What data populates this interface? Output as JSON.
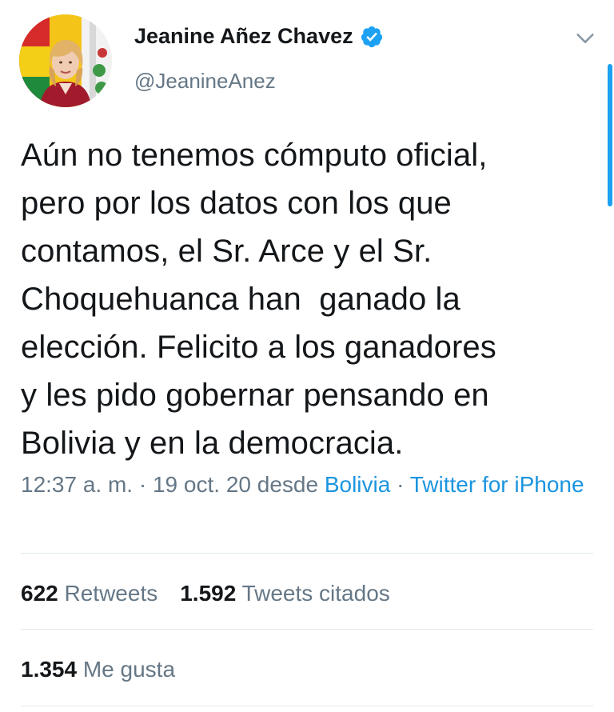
{
  "tweet": {
    "author": {
      "display_name": "Jeanine Añez Chavez",
      "handle": "@JeanineAnez",
      "verified": true,
      "avatar_icon": "profile-photo"
    },
    "text": "Aún no tenemos cómputo oficial,\npero por los datos con los que\ncontamos, el Sr. Arce y el Sr.\nChoquehuanca han  ganado la\nelección. Felicito a los ganadores\ny les pido gobernar pensando en\nBolivia y en la democracia.",
    "meta": {
      "time": "12:37 a. m.",
      "separator": " · ",
      "date": "19 oct. 20",
      "from_word": " desde ",
      "location": "Bolivia",
      "source": "Twitter for iPhone"
    },
    "stats": {
      "retweets_count": "622",
      "retweets_label": "Retweets",
      "quotes_count": "1.592",
      "quotes_label": "Tweets citados",
      "likes_count": "1.354",
      "likes_label": "Me gusta"
    }
  },
  "colors": {
    "link": "#1b95e0",
    "secondary_text": "#657786",
    "primary_text": "#14171a",
    "verified_badge": "#1da1f2",
    "divider": "#e1e8ed"
  },
  "icons": {
    "menu": "chevron-down-icon",
    "verified": "verified-badge-icon"
  }
}
